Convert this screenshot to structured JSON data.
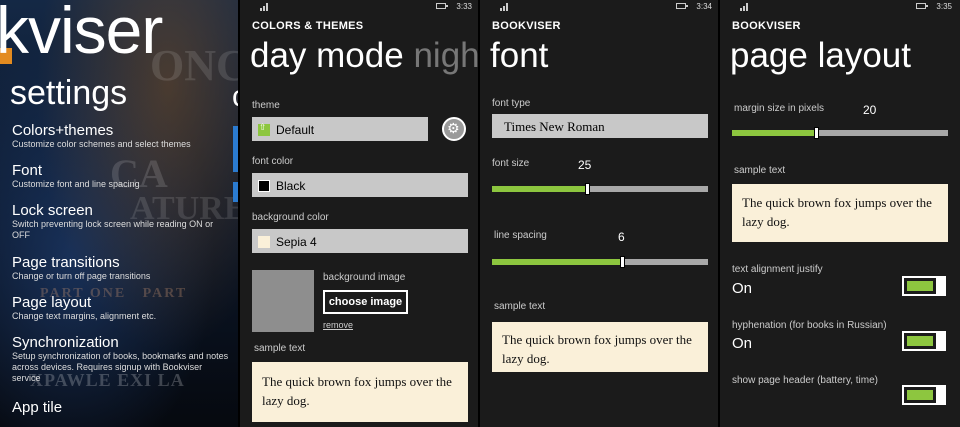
{
  "panel1": {
    "big_title": "kviser",
    "settings_title": "settings",
    "peek_letter": "c",
    "items": [
      {
        "title": "Colors+themes",
        "subtitle": "Customize color schemes and select themes"
      },
      {
        "title": "Font",
        "subtitle": "Customize font and line spacing"
      },
      {
        "title": "Lock screen",
        "subtitle": "Switch preventing lock screen while reading ON or OFF"
      },
      {
        "title": "Page transitions",
        "subtitle": "Change or turn off page transitions"
      },
      {
        "title": "Page layout",
        "subtitle": "Change text margins, alignment etc."
      },
      {
        "title": "Synchronization",
        "subtitle": "Setup synchronization of books, bookmarks and notes across devices. Requires signup with Bookviser service"
      },
      {
        "title": "App tile",
        "subtitle": ""
      }
    ]
  },
  "panel2": {
    "time": "3:33",
    "app_name": "COLORS & THEMES",
    "pivot_active": "day mode",
    "pivot_next": "nigh",
    "theme_label": "theme",
    "theme_value": "Default",
    "font_color_label": "font color",
    "font_color_value": "Black",
    "bg_color_label": "background color",
    "bg_color_value": "Sepia 4",
    "bg_image_label": "background image",
    "choose_image": "choose image",
    "remove": "remove",
    "sample_label": "sample text",
    "sample_text": "The quick brown fox jumps over the lazy dog."
  },
  "panel3": {
    "time": "3:34",
    "app_name": "BOOKVISER",
    "page_title": "font",
    "font_type_label": "font type",
    "font_type_value": "Times New Roman",
    "font_size_label": "font size",
    "font_size_value": "25",
    "font_size_fraction": 0.44,
    "line_spacing_label": "line spacing",
    "line_spacing_value": "6",
    "line_spacing_fraction": 0.6,
    "sample_label": "sample text",
    "sample_text": "The quick brown fox jumps over the lazy dog."
  },
  "panel4": {
    "time": "3:35",
    "app_name": "BOOKVISER",
    "page_title": "page layout",
    "margin_label": "margin size in pixels",
    "margin_value": "20",
    "margin_fraction": 0.39,
    "sample_label": "sample text",
    "sample_text": "The quick brown fox jumps over the lazy dog.",
    "justify_label": "text alignment justify",
    "justify_value": "On",
    "hyphen_label": "hyphenation (for books in Russian)",
    "hyphen_value": "On",
    "header_label": "show page header (battery, time)"
  },
  "colors": {
    "accent": "#8dc63f",
    "sepia": "#faf0d9",
    "field": "#c8c8c8",
    "orange": "#e38b20",
    "blue_accent": "#2b7bd0"
  }
}
